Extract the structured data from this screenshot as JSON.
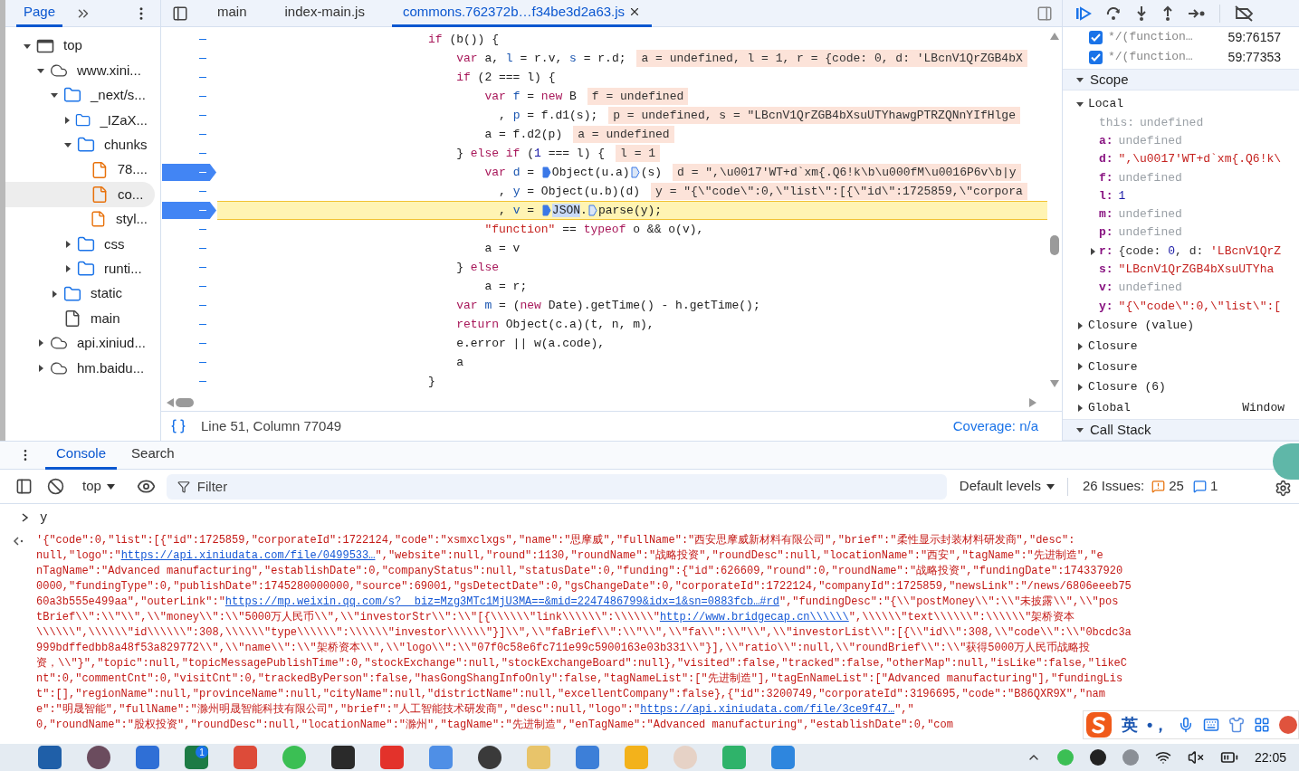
{
  "navigator": {
    "tabs": [
      {
        "label": "Page",
        "selected": true
      }
    ]
  },
  "file_tree": [
    {
      "label": "top",
      "kind": "frame",
      "expanded": true,
      "selected": false,
      "children": [
        {
          "label": "www.xini...",
          "kind": "domain",
          "expanded": true,
          "selected": false,
          "children": [
            {
              "label": "_next/s...",
              "kind": "folder",
              "expanded": true,
              "selected": false,
              "children": [
                {
                  "label": "_IZaX...",
                  "kind": "folder",
                  "expanded": false,
                  "selected": false
                },
                {
                  "label": "chunks",
                  "kind": "folder",
                  "expanded": true,
                  "selected": false,
                  "children": [
                    {
                      "label": "78....",
                      "kind": "script",
                      "selected": false
                    },
                    {
                      "label": "co...",
                      "kind": "script",
                      "selected": true
                    },
                    {
                      "label": "styl...",
                      "kind": "script",
                      "selected": false
                    }
                  ]
                },
                {
                  "label": "css",
                  "kind": "folder",
                  "expanded": false,
                  "selected": false
                },
                {
                  "label": "runti...",
                  "kind": "folder",
                  "expanded": false,
                  "selected": false
                }
              ]
            },
            {
              "label": "static",
              "kind": "folder",
              "expanded": false,
              "selected": false
            },
            {
              "label": "main",
              "kind": "document",
              "selected": false
            }
          ]
        },
        {
          "label": "api.xiniud...",
          "kind": "domain",
          "expanded": false,
          "selected": false
        },
        {
          "label": "hm.baidu...",
          "kind": "domain",
          "expanded": false,
          "selected": false
        }
      ]
    }
  ],
  "editor_tabs": [
    {
      "label": "main",
      "selected": false,
      "closable": false
    },
    {
      "label": "index-main.js",
      "selected": false,
      "closable": false
    },
    {
      "label": "commons.762372b…f34be3d2a63.js",
      "selected": true,
      "closable": true
    }
  ],
  "code": {
    "lines": [
      {
        "breakpoint": false,
        "current": false,
        "tokens": [
          {
            "kind": "kw",
            "text": "if"
          },
          {
            "kind": "p",
            "text": " (b()) {"
          }
        ]
      },
      {
        "breakpoint": false,
        "current": false,
        "tokens": [
          {
            "kind": "kw",
            "text": "    var"
          },
          {
            "kind": "p",
            "text": " a, "
          },
          {
            "kind": "v",
            "text": "l"
          },
          {
            "kind": "p",
            "text": " = r.v, "
          },
          {
            "kind": "v",
            "text": "s"
          },
          {
            "kind": "p",
            "text": " = r.d;"
          }
        ],
        "inline": "a = undefined, l = 1, r = {code: 0, d: 'LBcnV1QrZGB4bX"
      },
      {
        "breakpoint": false,
        "current": false,
        "tokens": [
          {
            "kind": "kw",
            "text": "    if"
          },
          {
            "kind": "p",
            "text": " (2 === l) {"
          }
        ]
      },
      {
        "breakpoint": false,
        "current": false,
        "tokens": [
          {
            "kind": "kw",
            "text": "        var "
          },
          {
            "kind": "v",
            "text": "f"
          },
          {
            "kind": "p",
            "text": " = "
          },
          {
            "kind": "kw",
            "text": "new"
          },
          {
            "kind": "p",
            "text": " B"
          }
        ],
        "inline": "f = undefined"
      },
      {
        "breakpoint": false,
        "current": false,
        "tokens": [
          {
            "kind": "p",
            "text": "          , "
          },
          {
            "kind": "v",
            "text": "p"
          },
          {
            "kind": "p",
            "text": " = f.d1(s);"
          }
        ],
        "inline": "p = undefined, s = \"LBcnV1QrZGB4bXsuUTYhawgPTRZQNnYIfHlge"
      },
      {
        "breakpoint": false,
        "current": false,
        "tokens": [
          {
            "kind": "p",
            "text": "        a = f.d2(p)"
          }
        ],
        "inline": "a = undefined"
      },
      {
        "breakpoint": false,
        "current": false,
        "tokens": [
          {
            "kind": "p",
            "text": "    } "
          },
          {
            "kind": "kw",
            "text": "else if"
          },
          {
            "kind": "p",
            "text": " ("
          },
          {
            "kind": "n",
            "text": "1"
          },
          {
            "kind": "p",
            "text": " === l) {"
          }
        ],
        "inline": "l = 1"
      },
      {
        "breakpoint": true,
        "current": false,
        "tokens": [
          {
            "kind": "kw",
            "text": "        var "
          },
          {
            "kind": "v",
            "text": "d"
          },
          {
            "kind": "p",
            "text": " = "
          },
          {
            "kind": "step_filled"
          },
          {
            "kind": "p",
            "text": "Object(u.a)"
          },
          {
            "kind": "step_open"
          },
          {
            "kind": "p",
            "text": "(s)"
          }
        ],
        "inline": "d = \",\\u0017'WT+d`xm{.Q6!k\\b\\u000fM\\u0016P6v\\b|y"
      },
      {
        "breakpoint": false,
        "current": false,
        "tokens": [
          {
            "kind": "p",
            "text": "          , "
          },
          {
            "kind": "v",
            "text": "y"
          },
          {
            "kind": "p",
            "text": " = Object(u.b)(d)"
          }
        ],
        "inline": "y = \"{\\\"code\\\":0,\\\"list\\\":[{\\\"id\\\":1725859,\\\"corpora"
      },
      {
        "breakpoint": true,
        "current": true,
        "tokens": [
          {
            "kind": "p",
            "text": "          , "
          },
          {
            "kind": "v",
            "text": "v"
          },
          {
            "kind": "p",
            "text": " = "
          },
          {
            "kind": "step_filled"
          },
          {
            "kind": "sel",
            "text": "JSON"
          },
          {
            "kind": "p",
            "text": "."
          },
          {
            "kind": "step_open"
          },
          {
            "kind": "p",
            "text": "parse(y);"
          }
        ]
      },
      {
        "breakpoint": false,
        "current": false,
        "tokens": [
          {
            "kind": "s",
            "text": "        \"function\""
          },
          {
            "kind": "p",
            "text": " == "
          },
          {
            "kind": "kw",
            "text": "typeof"
          },
          {
            "kind": "p",
            "text": " o && o(v),"
          }
        ]
      },
      {
        "breakpoint": false,
        "current": false,
        "tokens": [
          {
            "kind": "p",
            "text": "        a = v"
          }
        ]
      },
      {
        "breakpoint": false,
        "current": false,
        "tokens": [
          {
            "kind": "p",
            "text": "    } "
          },
          {
            "kind": "kw",
            "text": "else"
          }
        ]
      },
      {
        "breakpoint": false,
        "current": false,
        "tokens": [
          {
            "kind": "p",
            "text": "        a = r;"
          }
        ]
      },
      {
        "breakpoint": false,
        "current": false,
        "tokens": [
          {
            "kind": "kw",
            "text": "    var "
          },
          {
            "kind": "v",
            "text": "m"
          },
          {
            "kind": "p",
            "text": " = ("
          },
          {
            "kind": "kw",
            "text": "new"
          },
          {
            "kind": "p",
            "text": " Date).getTime() - h.getTime();"
          }
        ]
      },
      {
        "breakpoint": false,
        "current": false,
        "tokens": [
          {
            "kind": "kw",
            "text": "    return"
          },
          {
            "kind": "p",
            "text": " Object(c.a)(t, n, m),"
          }
        ]
      },
      {
        "breakpoint": false,
        "current": false,
        "tokens": [
          {
            "kind": "p",
            "text": "    e.error || w(a.code),"
          }
        ]
      },
      {
        "breakpoint": false,
        "current": false,
        "tokens": [
          {
            "kind": "p",
            "text": "    a"
          }
        ]
      },
      {
        "breakpoint": false,
        "current": false,
        "tokens": [
          {
            "kind": "p",
            "text": "}"
          }
        ]
      }
    ]
  },
  "editor_status": {
    "position": "Line 51, Column 77049",
    "coverage": "Coverage: n/a"
  },
  "breakpoints": [
    {
      "label": "*/(function…",
      "location": "59:76157",
      "checked": true
    },
    {
      "label": "*/(function…",
      "location": "59:77353",
      "checked": true
    }
  ],
  "scope": {
    "title": "Scope",
    "expanded": true,
    "sections": [
      {
        "label": "Local",
        "expanded": true,
        "variables": [
          {
            "name": "this:",
            "kind": "internal",
            "expandable": false,
            "value": [
              {
                "kind": "undefined",
                "text": "undefined"
              }
            ]
          },
          {
            "name": "a:",
            "kind": "own",
            "expandable": false,
            "value": [
              {
                "kind": "undefined",
                "text": "undefined"
              }
            ]
          },
          {
            "name": "d:",
            "kind": "own",
            "expandable": false,
            "value": [
              {
                "kind": "string",
                "text": "\",\\u0017'WT+d`xm{.Q6!k\\"
              }
            ]
          },
          {
            "name": "f:",
            "kind": "own",
            "expandable": false,
            "value": [
              {
                "kind": "undefined",
                "text": "undefined"
              }
            ]
          },
          {
            "name": "l:",
            "kind": "own",
            "expandable": false,
            "value": [
              {
                "kind": "number",
                "text": "1"
              }
            ]
          },
          {
            "name": "m:",
            "kind": "own",
            "expandable": false,
            "value": [
              {
                "kind": "undefined",
                "text": "undefined"
              }
            ]
          },
          {
            "name": "p:",
            "kind": "own",
            "expandable": false,
            "value": [
              {
                "kind": "undefined",
                "text": "undefined"
              }
            ]
          },
          {
            "name": "r:",
            "kind": "own",
            "expandable": true,
            "value": [
              {
                "kind": "plain",
                "text": "{code: "
              },
              {
                "kind": "number",
                "text": "0"
              },
              {
                "kind": "plain",
                "text": ", d: "
              },
              {
                "kind": "string",
                "text": "'LBcnV1QrZ"
              }
            ]
          },
          {
            "name": "s:",
            "kind": "own",
            "expandable": false,
            "value": [
              {
                "kind": "string",
                "text": "\"LBcnV1QrZGB4bXsuUTYha"
              }
            ]
          },
          {
            "name": "v:",
            "kind": "own",
            "expandable": false,
            "value": [
              {
                "kind": "undefined",
                "text": "undefined"
              }
            ]
          },
          {
            "name": "y:",
            "kind": "own",
            "expandable": false,
            "value": [
              {
                "kind": "string",
                "text": "\"{\\\"code\\\":0,\\\"list\\\":["
              }
            ]
          }
        ]
      },
      {
        "label": "Closure (value)",
        "expanded": false
      },
      {
        "label": "Closure",
        "expanded": false
      },
      {
        "label": "Closure",
        "expanded": false
      },
      {
        "label": "Closure (6)",
        "expanded": false
      },
      {
        "label": "Global",
        "value": "Window",
        "expanded": false
      }
    ]
  },
  "call_stack": {
    "title": "Call Stack",
    "expanded": true
  },
  "drawer_tabs": [
    {
      "label": "Console",
      "selected": true
    },
    {
      "label": "Search",
      "selected": false
    }
  ],
  "console_toolbar": {
    "context": "top",
    "filter": {
      "placeholder": "Filter"
    },
    "levels": "Default levels",
    "issues_label": "26 Issues:",
    "warnings": "25",
    "infos": "1"
  },
  "console": {
    "command": "y",
    "output": [
      [
        {
          "kind": "text",
          "text": "'{\"code\":0,\"list\":[{\"id\":1725859,\"corporateId\":1722124,\"code\":\"xsmxclxgs\",\"name\":\"思摩威\",\"fullName\":\"西安思摩威新材料有限公司\",\"brief\":\"柔性显示封装材料研发商\",\"desc\":"
        }
      ],
      [
        {
          "kind": "text",
          "text": "null,\"logo\":\""
        },
        {
          "kind": "link",
          "text": "https://api.xiniudata.com/file/0499533…"
        },
        {
          "kind": "text",
          "text": "\",\"website\":null,\"round\":1130,\"roundName\":\"战略投资\",\"roundDesc\":null,\"locationName\":\"西安\",\"tagName\":\"先进制造\",\"e"
        }
      ],
      [
        {
          "kind": "text",
          "text": "nTagName\":\"Advanced manufacturing\",\"establishDate\":0,\"companyStatus\":null,\"statusDate\":0,\"funding\":{\"id\":626609,\"round\":0,\"roundName\":\"战略投资\",\"fundingDate\":174337920"
        }
      ],
      [
        {
          "kind": "text",
          "text": "0000,\"fundingType\":0,\"publishDate\":1745280000000,\"source\":69001,\"gsDetectDate\":0,\"gsChangeDate\":0,\"corporateId\":1722124,\"companyId\":1725859,\"newsLink\":\"/news/6806eeeb75"
        }
      ],
      [
        {
          "kind": "text",
          "text": "60a3b555e499aa\",\"outerLink\":\""
        },
        {
          "kind": "link",
          "text": "https://mp.weixin.qq.com/s?__biz=Mzg3MTc1MjU3MA==&mid=2247486799&idx=1&sn=0883fcb…#rd"
        },
        {
          "kind": "text",
          "text": "\",\"fundingDesc\":\"{\\\\\"postMoney\\\\\":\\\\\"未披露\\\\\",\\\\\"pos"
        }
      ],
      [
        {
          "kind": "text",
          "text": "tBrief\\\\\":\\\\\"\\\\\",\\\\\"money\\\\\":\\\\\"5000万人民币\\\\\",\\\\\"investorStr\\\\\":\\\\\"[{\\\\\\\\\\\\\"link\\\\\\\\\\\\\":\\\\\\\\\\\\\""
        },
        {
          "kind": "link",
          "text": "http://www.bridgecap.cn\\\\\\\\\\\\"
        },
        {
          "kind": "text",
          "text": "\",\\\\\\\\\\\\\"text\\\\\\\\\\\\\":\\\\\\\\\\\\\"架桥资本"
        }
      ],
      [
        {
          "kind": "text",
          "text": "\\\\\\\\\\\\\",\\\\\\\\\\\\\"id\\\\\\\\\\\\\":308,\\\\\\\\\\\\\"type\\\\\\\\\\\\\":\\\\\\\\\\\\\"investor\\\\\\\\\\\\\"}]\\\\\",\\\\\"faBrief\\\\\":\\\\\"\\\\\",\\\\\"fa\\\\\":\\\\\"\\\\\",\\\\\"investorList\\\\\":[{\\\\\"id\\\\\":308,\\\\\"code\\\\\":\\\\\"0bcdc3a"
        }
      ],
      [
        {
          "kind": "text",
          "text": "999bdffedbb8a48f53a829772\\\\\",\\\\\"name\\\\\":\\\\\"架桥资本\\\\\",\\\\\"logo\\\\\":\\\\\"07f0c58e6fc711e99c5900163e03b331\\\\\"}],\\\\\"ratio\\\\\":null,\\\\\"roundBrief\\\\\":\\\\\"获得5000万人民币战略投"
        }
      ],
      [
        {
          "kind": "text",
          "text": "资，\\\\\"}\",\"topic\":null,\"topicMessagePublishTime\":0,\"stockExchange\":null,\"stockExchangeBoard\":null},\"visited\":false,\"tracked\":false,\"otherMap\":null,\"isLike\":false,\"likeC"
        }
      ],
      [
        {
          "kind": "text",
          "text": "nt\":0,\"commentCnt\":0,\"visitCnt\":0,\"trackedByPerson\":false,\"hasGongShangInfoOnly\":false,\"tagNameList\":[\"先进制造\"],\"tagEnNameList\":[\"Advanced manufacturing\"],\"fundingLis"
        }
      ],
      [
        {
          "kind": "text",
          "text": "t\":[],\"regionName\":null,\"provinceName\":null,\"cityName\":null,\"districtName\":null,\"excellentCompany\":false},{\"id\":3200749,\"corporateId\":3196695,\"code\":\"B86QXR9X\",\"nam"
        }
      ],
      [
        {
          "kind": "text",
          "text": "e\":\"明晟智能\",\"fullName\":\"滁州明晟智能科技有限公司\",\"brief\":\"人工智能技术研发商\",\"desc\":null,\"logo\":\""
        },
        {
          "kind": "link",
          "text": "https://api.xiniudata.com/file/3ce9f47…"
        },
        {
          "kind": "text",
          "text": "\",\""
        }
      ],
      [
        {
          "kind": "text",
          "text": "0,\"roundName\":\"股权投资\",\"roundDesc\":null,\"locationName\":\"滁州\",\"tagName\":\"先进制造\",\"enTagName\":\"Advanced manufacturing\",\"establishDate\":0,\"com"
        }
      ]
    ]
  },
  "ime_bar": {
    "mode": "英",
    "punctuation": "•，"
  },
  "taskbar": {
    "badge": "1",
    "time": "22:05"
  }
}
